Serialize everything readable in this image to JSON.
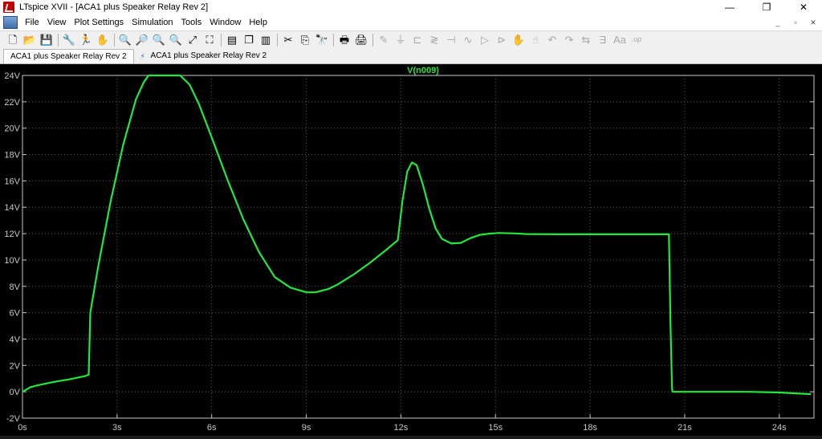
{
  "window": {
    "title": "LTspice XVII - [ACA1 plus Speaker Relay Rev 2]",
    "controls": [
      "—",
      "❐",
      "✕"
    ]
  },
  "menu": {
    "items": [
      "File",
      "View",
      "Plot Settings",
      "Simulation",
      "Tools",
      "Window",
      "Help"
    ],
    "mdi_controls": [
      "_",
      "▫",
      "✕"
    ]
  },
  "toolbar": {
    "icons": [
      {
        "name": "new-schematic-icon",
        "glyph": "🗋"
      },
      {
        "name": "open-icon",
        "glyph": "📂"
      },
      {
        "name": "save-icon",
        "glyph": "💾"
      },
      {
        "name": "control-panel-icon",
        "glyph": "🔧"
      },
      {
        "name": "run-icon",
        "glyph": "🏃"
      },
      {
        "name": "halt-icon",
        "glyph": "✋"
      },
      {
        "name": "zoom-in-icon",
        "glyph": "🔍"
      },
      {
        "name": "pan-icon",
        "glyph": "🔎"
      },
      {
        "name": "zoom-out-icon",
        "glyph": "🔍"
      },
      {
        "name": "zoom-cancel-icon",
        "glyph": "🔍"
      },
      {
        "name": "autorange-icon",
        "glyph": "⤢"
      },
      {
        "name": "zoom-extents-icon",
        "glyph": "⛶"
      },
      {
        "name": "tile-horizontal-icon",
        "glyph": "▤"
      },
      {
        "name": "cascade-icon",
        "glyph": "❐"
      },
      {
        "name": "tile-vertical-icon",
        "glyph": "▥"
      },
      {
        "name": "cut-icon",
        "glyph": "✂"
      },
      {
        "name": "copy-icon",
        "glyph": "⎘"
      },
      {
        "name": "find-icon",
        "glyph": "🔭"
      },
      {
        "name": "print-icon",
        "glyph": "🖶"
      },
      {
        "name": "print-setup-icon",
        "glyph": "🖨"
      },
      {
        "name": "draw-wire-icon",
        "glyph": "✎"
      },
      {
        "name": "ground-icon",
        "glyph": "⏚"
      },
      {
        "name": "label-net-icon",
        "glyph": "⊏"
      },
      {
        "name": "resistor-icon",
        "glyph": "≷"
      },
      {
        "name": "capacitor-icon",
        "glyph": "⊣"
      },
      {
        "name": "inductor-icon",
        "glyph": "∿"
      },
      {
        "name": "diode-icon",
        "glyph": "▷"
      },
      {
        "name": "component-icon",
        "glyph": "⊳"
      },
      {
        "name": "move-icon",
        "glyph": "✋"
      },
      {
        "name": "drag-icon",
        "glyph": "☝"
      },
      {
        "name": "undo-icon",
        "glyph": "↶"
      },
      {
        "name": "redo-icon",
        "glyph": "↷"
      },
      {
        "name": "rotate-icon",
        "glyph": "⇆"
      },
      {
        "name": "mirror-icon",
        "glyph": "Ǝ"
      },
      {
        "name": "text-icon",
        "glyph": "Aa"
      },
      {
        "name": "spice-directive-icon",
        "glyph": ".op"
      }
    ]
  },
  "tabs": [
    {
      "label": "ACA1 plus Speaker Relay Rev 2",
      "active": true
    },
    {
      "label": "ACA1 plus Speaker Relay Rev 2",
      "active": false
    }
  ],
  "colors": {
    "plot_background": "#000000",
    "trace": "#22e83a",
    "axis_text": "#c8c8c8",
    "grid": "#5a5a5a",
    "frame": "#c8c8c8"
  },
  "chart_data": {
    "type": "line",
    "title": "V(n009)",
    "xlabel": "",
    "ylabel": "",
    "xlim": [
      0,
      25.1
    ],
    "ylim": [
      -2,
      24
    ],
    "grid": true,
    "legend": "top-center",
    "x_ticks": [
      "0s",
      "3s",
      "6s",
      "9s",
      "12s",
      "15s",
      "18s",
      "21s",
      "24s"
    ],
    "x_tick_values": [
      0,
      3,
      6,
      9,
      12,
      15,
      18,
      21,
      24
    ],
    "y_ticks": [
      "-2V",
      "0V",
      "2V",
      "4V",
      "6V",
      "8V",
      "10V",
      "12V",
      "14V",
      "16V",
      "18V",
      "20V",
      "22V",
      "24V"
    ],
    "y_tick_values": [
      -2,
      0,
      2,
      4,
      6,
      8,
      10,
      12,
      14,
      16,
      18,
      20,
      22,
      24
    ],
    "series": [
      {
        "name": "V(n009)",
        "x": [
          0,
          0.25,
          0.5,
          1.0,
          1.5,
          2.0,
          2.1,
          2.15,
          2.4,
          2.8,
          3.2,
          3.6,
          3.85,
          4.0,
          4.4,
          4.8,
          5.0,
          5.3,
          5.6,
          6.0,
          6.5,
          7.0,
          7.5,
          8.0,
          8.5,
          9.0,
          9.3,
          9.7,
          10.0,
          10.5,
          11.0,
          11.5,
          11.9,
          12.05,
          12.2,
          12.35,
          12.5,
          12.7,
          12.9,
          13.1,
          13.3,
          13.6,
          13.9,
          14.2,
          14.5,
          14.8,
          15.1,
          15.5,
          16,
          17,
          18,
          19,
          20,
          20.5,
          20.55,
          20.6,
          20.62,
          21,
          22,
          23,
          24,
          24.5,
          25.0
        ],
        "y": [
          0,
          0.35,
          0.5,
          0.75,
          0.95,
          1.2,
          1.3,
          6.0,
          9.5,
          14.5,
          18.8,
          22.2,
          23.5,
          24,
          24,
          24,
          24,
          23.3,
          21.8,
          19.3,
          16.1,
          13.1,
          10.6,
          8.7,
          7.9,
          7.55,
          7.55,
          7.8,
          8.15,
          8.9,
          9.75,
          10.7,
          11.5,
          14.5,
          16.7,
          17.4,
          17.2,
          15.7,
          13.9,
          12.4,
          11.6,
          11.25,
          11.3,
          11.65,
          11.9,
          12.0,
          12.05,
          12.02,
          11.97,
          11.95,
          11.95,
          11.95,
          11.95,
          11.95,
          5.0,
          0.2,
          0.0,
          0.0,
          0.0,
          0.0,
          -0.05,
          -0.12,
          -0.18
        ]
      }
    ]
  }
}
